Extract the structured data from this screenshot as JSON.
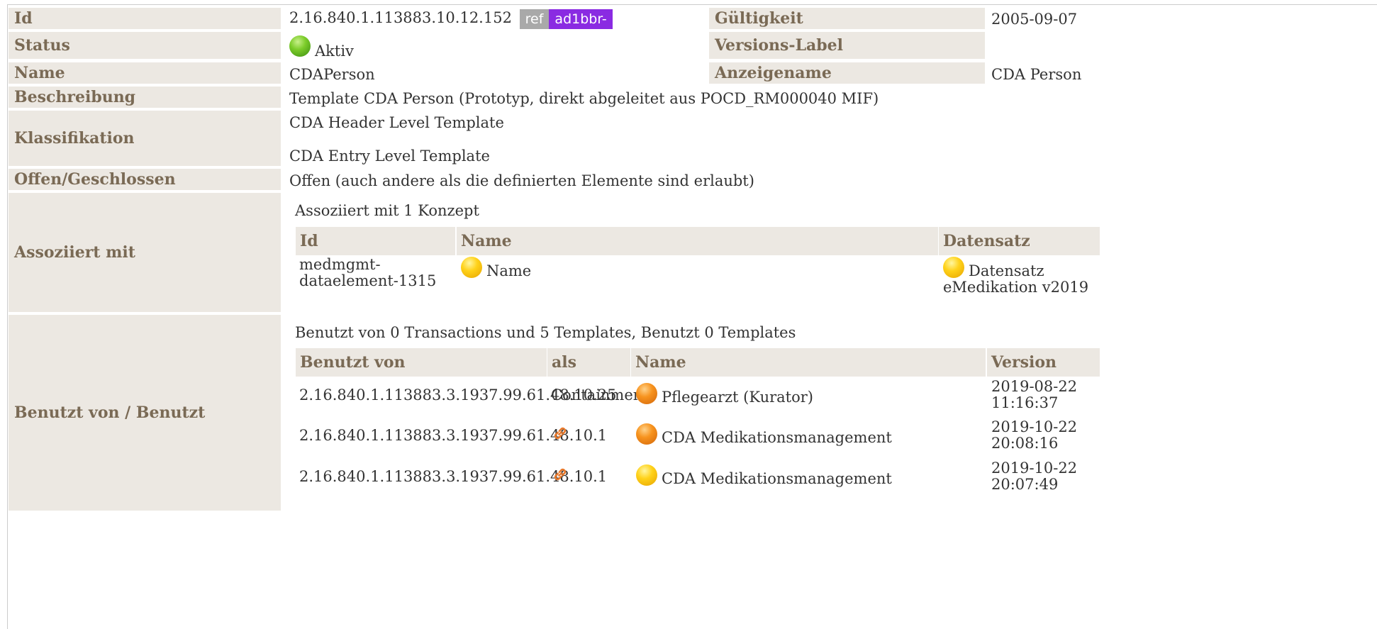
{
  "rows": {
    "id": {
      "label": "Id",
      "value": "2.16.840.1.113883.10.12.152",
      "badge_ref": "ref",
      "badge_id": "ad1bbr-"
    },
    "gueltigkeit": {
      "label": "Gültigkeit",
      "value": "2005-09-07"
    },
    "status": {
      "label": "Status",
      "value": "Aktiv"
    },
    "versions_label": {
      "label": "Versions-Label",
      "value": ""
    },
    "name": {
      "label": "Name",
      "value": "CDAPerson"
    },
    "anzeigename": {
      "label": "Anzeigename",
      "value": "CDA Person"
    },
    "beschreibung": {
      "label": "Beschreibung",
      "value": "Template CDA Person (Prototyp, direkt abgeleitet aus POCD_RM000040 MIF)"
    },
    "klassifikation": {
      "label": "Klassifikation",
      "values": [
        "CDA Header Level Template",
        "CDA Entry Level Template"
      ]
    },
    "offen": {
      "label": "Offen/Geschlossen",
      "value": "Offen (auch andere als die definierten Elemente sind erlaubt)"
    },
    "assoziiert": {
      "label": "Assoziiert mit",
      "summary": "Assoziiert mit 1 Konzept",
      "headers": [
        "Id",
        "Name",
        "Datensatz"
      ],
      "rows": [
        {
          "id_line1": "medmgmt-",
          "id_line2": "dataelement-1315",
          "name": "Name",
          "datensatz_line1": "Datensatz",
          "datensatz_line2": "eMedikation v2019"
        }
      ]
    },
    "benutzt": {
      "label": "Benutzt von / Benutzt",
      "summary": "Benutzt von 0 Transactions und 5 Templates, Benutzt 0 Templates",
      "headers": [
        "Benutzt von",
        "als",
        "Name",
        "Version"
      ],
      "rows": [
        {
          "id": "2.16.840.1.113883.3.1937.99.61.48.10.25",
          "als": "Containment",
          "name": "Pflegearzt (Kurator)",
          "date": "2019-08-22",
          "time": "11:16:37",
          "status": "orange"
        },
        {
          "id": "2.16.840.1.113883.3.1937.99.61.48.10.1",
          "als": "link-icon",
          "name": "CDA Medikationsmanagement",
          "date": "2019-10-22",
          "time": "20:08:16",
          "status": "orange"
        },
        {
          "id": "2.16.840.1.113883.3.1937.99.61.48.10.1",
          "als": "link-icon",
          "name": "CDA Medikationsmanagement",
          "date": "2019-10-22",
          "time": "20:07:49",
          "status": "yellow"
        }
      ]
    }
  },
  "colors": {
    "header_bg": "#ece8e2",
    "header_text": "#7a6a55",
    "badge_ref": "#a9a9a9",
    "badge_id": "#8a2be2"
  }
}
